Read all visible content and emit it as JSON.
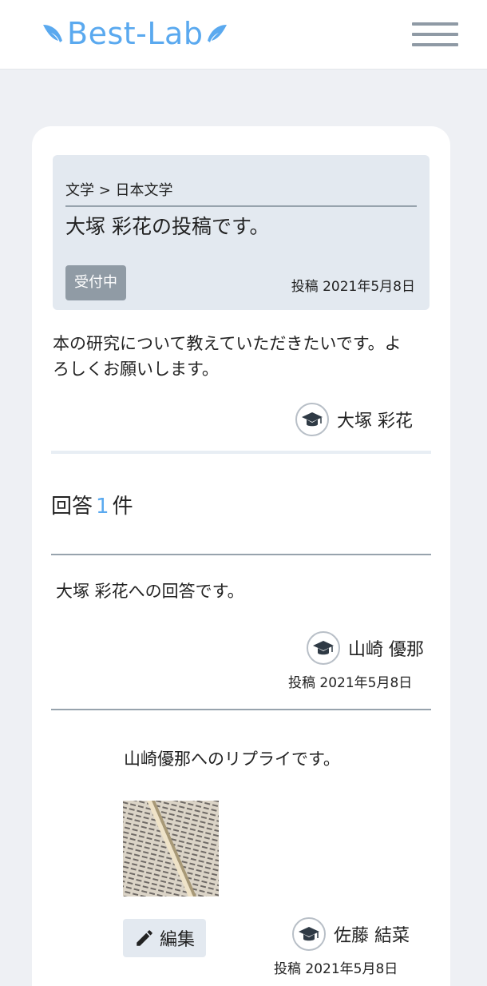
{
  "header": {
    "logo_text": "Best-Lab",
    "menu_icon": "hamburger-menu-icon",
    "brand_color": "#5aa9ef"
  },
  "question": {
    "breadcrumb": "文学 > 日本文学",
    "title": "大塚 彩花の投稿です。",
    "status_badge": "受付中",
    "date": "投稿 2021年5月8日",
    "body": "本の研究について教えていただきたいです。よろしくお願いします。",
    "author": "大塚 彩花",
    "author_icon": "graduation-cap-icon"
  },
  "answers": {
    "label_prefix": "回答",
    "count": "1",
    "label_suffix": "件"
  },
  "answer": {
    "text": "大塚 彩花への回答です。",
    "author": "山崎 優那",
    "date": "投稿 2021年5月8日"
  },
  "reply": {
    "text": "山崎優那へのリプライです。",
    "image_alt": "book-photo",
    "edit_label": "編集",
    "edit_icon": "pencil-icon",
    "author": "佐藤 結菜",
    "date": "投稿 2021年5月8日"
  }
}
